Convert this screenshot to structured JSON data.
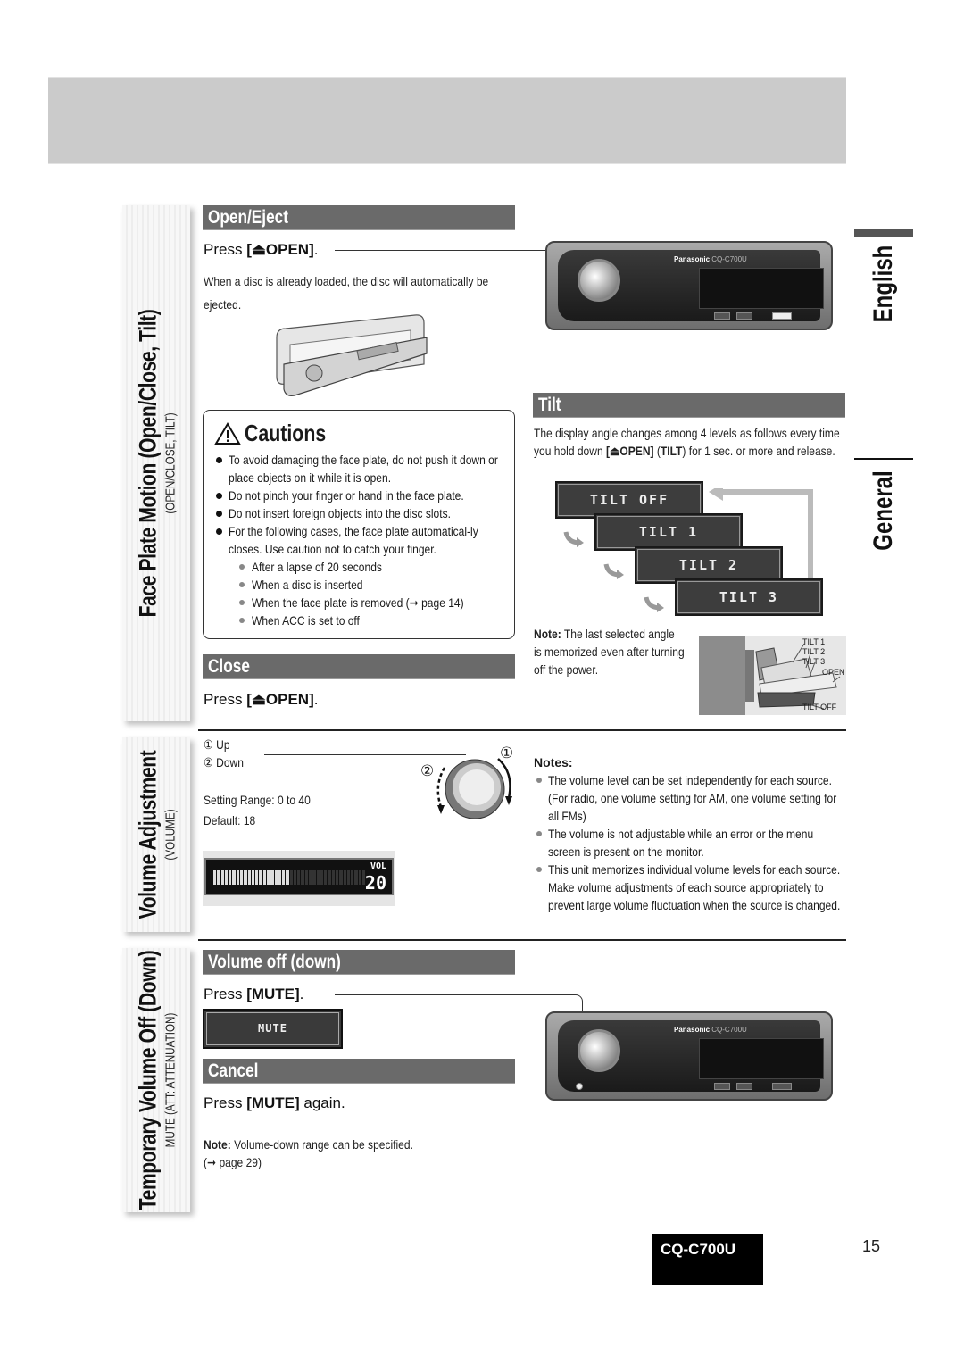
{
  "page": {
    "language_tab": "English",
    "category_tab": "General",
    "model_badge": "CQ-C700U",
    "page_number": "15"
  },
  "side_tabs": [
    {
      "title": "Face Plate Motion (Open/Close, Tilt)",
      "subtitle": "(OPEN/CLOSE, TILT)"
    },
    {
      "title": "Volume Adjustment",
      "subtitle": "(VOLUME)"
    },
    {
      "title": "Temporary Volume Off (Down)",
      "subtitle": "MUTE (ATT: ATTENUATION)"
    }
  ],
  "open_eject": {
    "header": "Open/Eject",
    "press_prefix": "Press ",
    "press_key": "[⏏OPEN]",
    "press_suffix": ".",
    "description": "When a disc is already loaded, the disc will automatically be ejected."
  },
  "cautions": {
    "title": "Cautions",
    "items": [
      "To avoid damaging the face plate, do not push it down or place objects on it while it is open.",
      "Do not pinch your finger or hand in the face plate.",
      "Do not insert foreign objects into the disc slots.",
      "For the following cases, the face plate automatical-ly closes. Use caution not to catch your finger."
    ],
    "sub_items": [
      "After a lapse of 20 seconds",
      "When a disc is inserted",
      "When the face plate is removed (➞ page 14)",
      "When ACC is set to off"
    ]
  },
  "close": {
    "header": "Close",
    "press_prefix": "Press ",
    "press_key": "[⏏OPEN]",
    "press_suffix": "."
  },
  "tilt": {
    "header": "Tilt",
    "description_1": "The display angle changes among 4 levels as follows every time you hold down ",
    "description_key": "[⏏OPEN]",
    "description_2": " (",
    "description_key2": "TILT",
    "description_3": ") for 1 sec. or more and release.",
    "levels": [
      "TILT OFF",
      "TILT  1",
      "TILT  2",
      "TILT  3"
    ],
    "note_label": "Note:",
    "note_text": " The last selected angle is memorized even after turning off the power.",
    "diagram_labels": [
      "TILT 1",
      "TILT 2",
      "TILT 3",
      "OPEN",
      "TILT OFF"
    ]
  },
  "stereo": {
    "brand": "Panasonic",
    "model": "CQ-C700U"
  },
  "volume": {
    "up_label": "① Up",
    "down_label": "② Down",
    "callout_up": "①",
    "callout_down": "②",
    "range": "Setting Range: 0 to 40",
    "default": "Default: 18",
    "display_label": "VOL",
    "display_value": "20",
    "display_level_fraction": 0.5,
    "notes_title": "Notes:",
    "notes": [
      "The volume level can be set independently for each source. (For radio, one volume setting for AM, one volume setting for all FMs)",
      "The volume is not adjustable while an error or the menu screen is present on the monitor.",
      "This unit memorizes individual volume levels for each source. Make volume adjustments of each source appropriately to prevent large volume fluctuation when the source is changed."
    ]
  },
  "mute": {
    "header": "Volume off (down)",
    "press_prefix": "Press ",
    "press_key": "[MUTE]",
    "press_suffix": ".",
    "display": "MUTE",
    "cancel_header": "Cancel",
    "cancel_prefix": "Press ",
    "cancel_key": "[MUTE]",
    "cancel_suffix": " again.",
    "note_label": "Note:",
    "note_text": " Volume-down range can be specified.",
    "note_ref": "(➞ page 29)"
  }
}
